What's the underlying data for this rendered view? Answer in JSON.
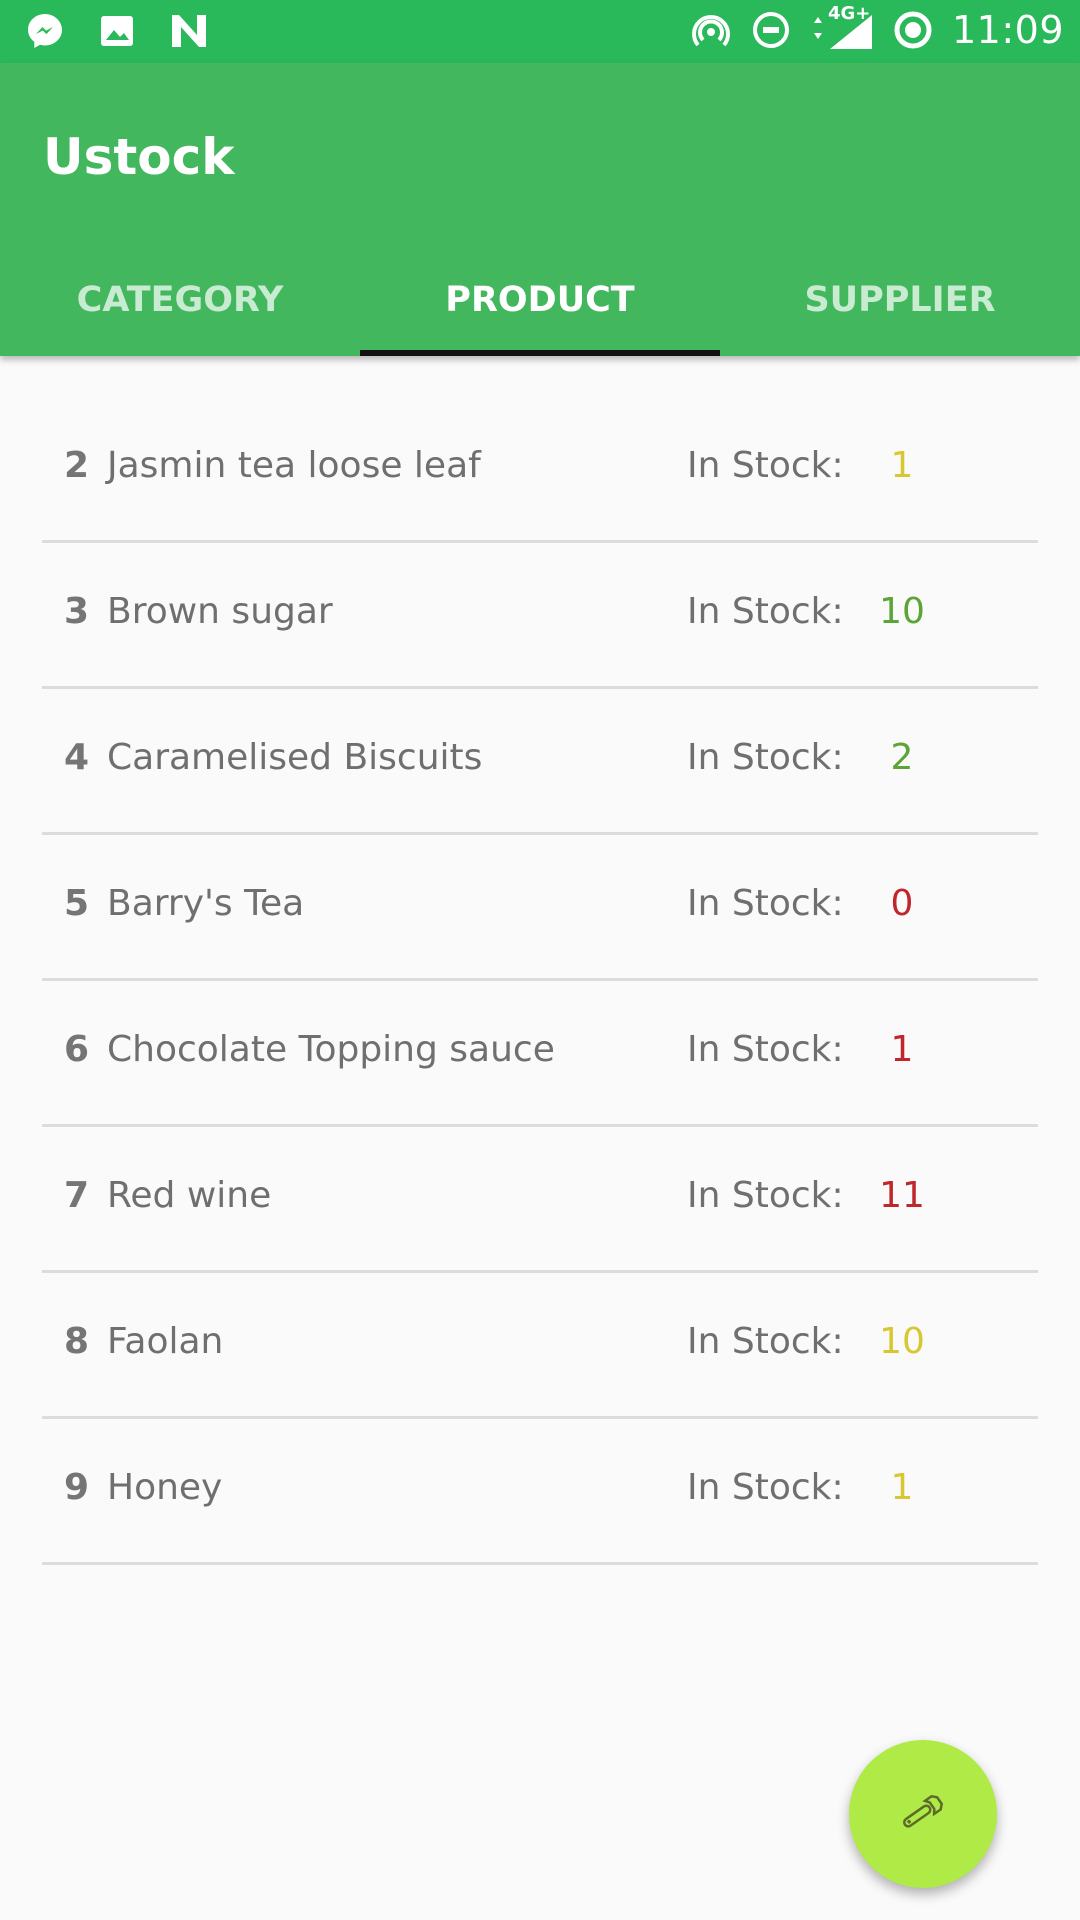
{
  "status_bar": {
    "time": "11:09",
    "network_label": "4G+",
    "left_icons": [
      "messenger-icon",
      "image-icon",
      "n-app-icon"
    ],
    "right_icons": [
      "hotspot-icon",
      "dnd-icon",
      "signal-icon",
      "sync-icon"
    ]
  },
  "app": {
    "title": "Ustock",
    "colors": {
      "status_bar": "#2ab95a",
      "app_bar": "#43b75e",
      "fab": "#b0ea47"
    }
  },
  "tabs": [
    {
      "label": "CATEGORY",
      "active": false
    },
    {
      "label": "PRODUCT",
      "active": true
    },
    {
      "label": "SUPPLIER",
      "active": false
    }
  ],
  "products": [
    {
      "id": "2",
      "name": "Jasmin tea loose leaf",
      "stock_label": "In Stock:",
      "stock": "1",
      "color": "#d8c733"
    },
    {
      "id": "3",
      "name": "Brown sugar",
      "stock_label": "In Stock:",
      "stock": "10",
      "color": "#5ba435"
    },
    {
      "id": "4",
      "name": "Caramelised Biscuits",
      "stock_label": "In Stock:",
      "stock": "2",
      "color": "#5ba435"
    },
    {
      "id": "5",
      "name": "Barry's Tea",
      "stock_label": "In Stock:",
      "stock": "0",
      "color": "#c0272d"
    },
    {
      "id": "6",
      "name": "Chocolate Topping sauce",
      "stock_label": "In Stock:",
      "stock": "1",
      "color": "#c0272d"
    },
    {
      "id": "7",
      "name": "Red wine",
      "stock_label": "In Stock:",
      "stock": "11",
      "color": "#c0272d"
    },
    {
      "id": "8",
      "name": "Faolan",
      "stock_label": "In Stock:",
      "stock": "10",
      "color": "#d8c733"
    },
    {
      "id": "9",
      "name": "Honey",
      "stock_label": "In Stock:",
      "stock": "1",
      "color": "#d8c733"
    }
  ],
  "fab": {
    "icon": "wrench-icon"
  }
}
